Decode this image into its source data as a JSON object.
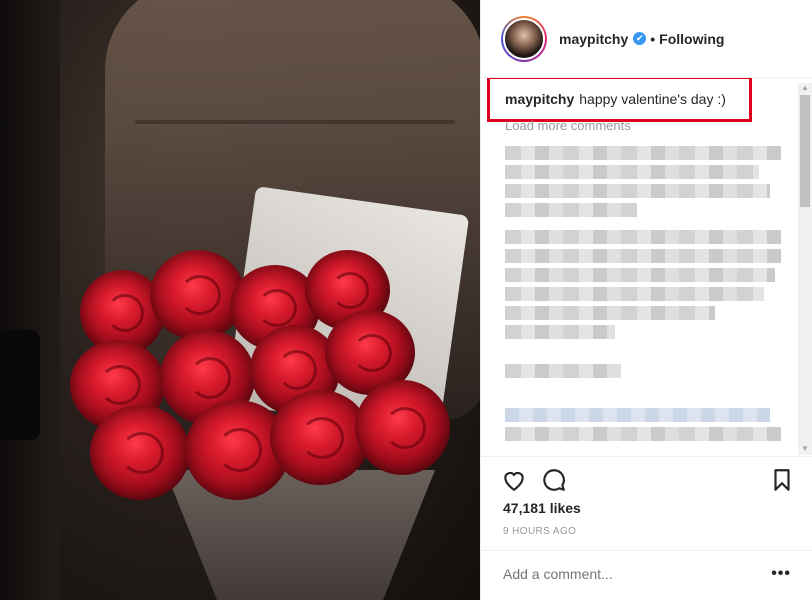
{
  "header": {
    "username": "maypitchy",
    "verified_mark": "✔",
    "separator": "•",
    "follow_status": "Following"
  },
  "caption": {
    "username": "maypitchy",
    "text": "happy valentine's day :)"
  },
  "comments": {
    "load_more_label": "Load more comments"
  },
  "actions": {
    "like_icon": "heart-icon",
    "comment_icon": "comment-icon",
    "save_icon": "bookmark-icon"
  },
  "likes": "47,181 likes",
  "time_ago": "9 HOURS AGO",
  "add_comment": {
    "placeholder": "Add a comment...",
    "more_label": "•••"
  },
  "colors": {
    "highlight_box": "#e0001b",
    "verified_badge": "#3897f0"
  }
}
